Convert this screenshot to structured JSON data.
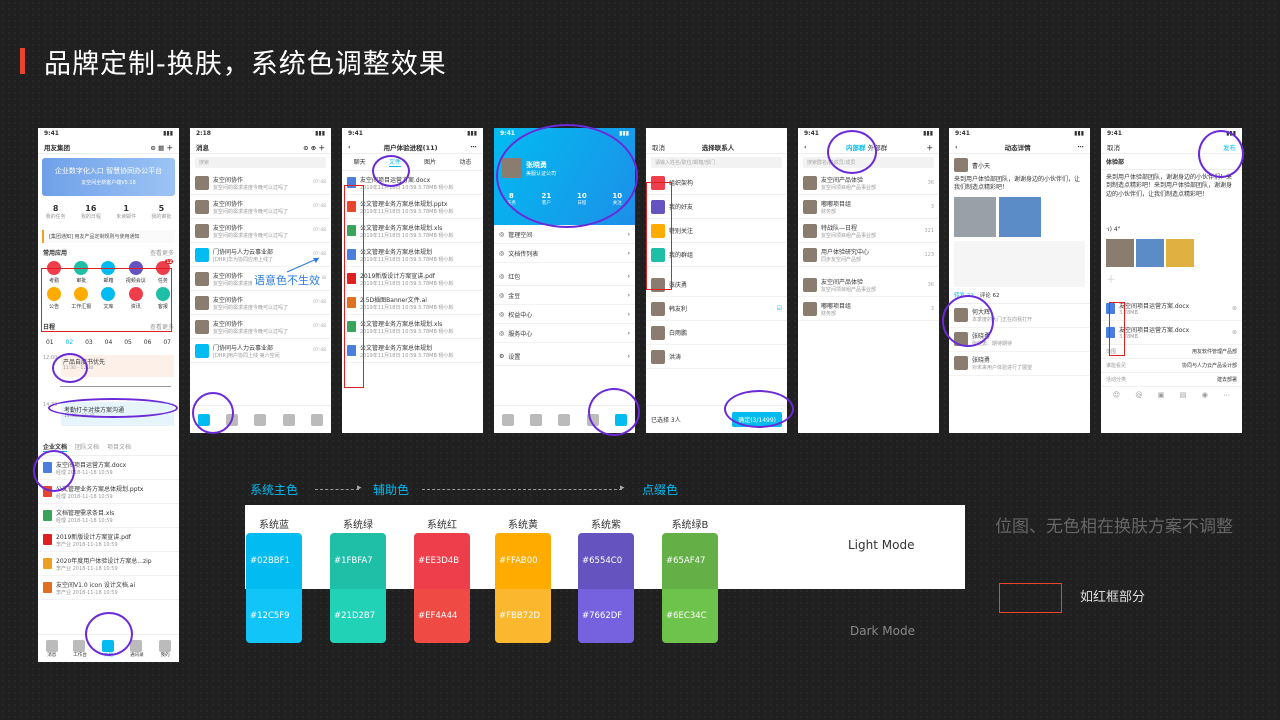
{
  "page_title": "品牌定制-换肤，系统色调整效果",
  "phone1": {
    "time": "9:41",
    "org": "用友集团",
    "banner": "企业数字化入口 智慧协同办公平台",
    "banner_sub": "友空间全新客户端V5.18",
    "stats": [
      {
        "v": "8",
        "l": "我的任务"
      },
      {
        "v": "16",
        "l": "我的日程"
      },
      {
        "v": "1",
        "l": "未读邮件"
      },
      {
        "v": "5",
        "l": "我的审批"
      }
    ],
    "notice": "[集团通知] 用友产品定制规则与使用通知",
    "apps_title": "常用应用",
    "apps_more": "查看更多",
    "apps": [
      "考勤",
      "审批",
      "邮箱",
      "视频会议",
      "任务",
      "公告",
      "工作汇报",
      "文库",
      "资讯",
      "客报"
    ],
    "apps_badge": "12",
    "cal_title": "日程",
    "cal_more": "查看更多",
    "days": [
      "01",
      "02",
      "03",
      "04",
      "05",
      "06",
      "07"
    ],
    "events": [
      {
        "t": "12:00",
        "n": "产品自度书优先",
        "s": "11:30 - 12:30"
      },
      {
        "t": "14:30",
        "n": "考勤打卡对接方案沟通",
        "s": "14:30 - 15:30"
      }
    ],
    "doc_tabs": [
      "企业文档",
      "团队文档",
      "项目文档"
    ],
    "docs": [
      {
        "n": "友空间项目运营方案.docx",
        "m": "经理 2018-11-18 10:59",
        "c": "#4a7fe0"
      },
      {
        "n": "公文管理业务方案总体规划.pptx",
        "m": "经理 2018-11-18 10:59",
        "c": "#e8452c"
      },
      {
        "n": "文档管理需求条目.xls",
        "m": "经理 2018-11-18 10:59",
        "c": "#3aa55a"
      },
      {
        "n": "2019新版设计方案宣讲.pdf",
        "m": "李产业 2018-11-18 10:59",
        "c": "#e02020"
      },
      {
        "n": "2020年度用户体验设计方案总...zip",
        "m": "李产业 2018-11-18 10:59",
        "c": "#f0a020"
      },
      {
        "n": "友空间V1.0 icon 设计文档.ai",
        "m": "李产业 2018-11-18 10:59",
        "c": "#e07020"
      }
    ],
    "tabs": [
      "消息",
      "工作台",
      "文档",
      "通讯录",
      "我的"
    ]
  },
  "phone2": {
    "time": "2:18",
    "title": "消息",
    "search": "搜索",
    "items": [
      {
        "n": "友空间协作",
        "s": "友空间的需求进度今晚可以过吗了",
        "t": "07:48"
      },
      {
        "n": "友空间协作",
        "s": "友空间的需求进度今晚可以过吗了",
        "t": "07:48"
      },
      {
        "n": "友空间协作",
        "s": "友空间的需求进度今晚可以过吗了",
        "t": "07:48"
      },
      {
        "n": "门协同与人力云事业部",
        "s": "[DHR]华为协同应用上线了",
        "t": "07:48"
      },
      {
        "n": "友空间协作",
        "s": "友空间的需求进度今晚可以过吗了",
        "t": "07:48"
      },
      {
        "n": "友空间协作",
        "s": "友空间的需求进度今晚可以过吗了",
        "t": "07:48"
      },
      {
        "n": "友空间协作",
        "s": "友空间的需求进度今晚可以过吗了",
        "t": "07:48"
      },
      {
        "n": "门协同与人力云事业部",
        "s": "[DHR]用户协同上线 第六空间",
        "t": "07:48"
      }
    ],
    "note": "语意色不生效"
  },
  "phone3": {
    "time": "9:41",
    "title": "用户体验进程(11)",
    "tabs": [
      "聊天",
      "文件",
      "图片",
      "动态"
    ],
    "files": [
      {
        "n": "友空间项目运营方案.docx",
        "c": "#4a7fe0"
      },
      {
        "n": "公文管理业务方案总体规划.pptx",
        "c": "#e8452c"
      },
      {
        "n": "公文管理业务方案总体规划.xls",
        "c": "#3aa55a"
      },
      {
        "n": "公文管理业务方案总体规划",
        "c": "#4a7fe0"
      },
      {
        "n": "2019新版设计方案宣讲.pdf",
        "c": "#e02020"
      },
      {
        "n": "2.5D插图Banner文件.ai",
        "c": "#e07020"
      },
      {
        "n": "公文管理业务方案总体规划.xls",
        "c": "#3aa55a"
      },
      {
        "n": "公文管理业务方案总体规划",
        "c": "#4a7fe0"
      }
    ],
    "meta": "2019年11月18日 10:59  3.78MB  杨小彬"
  },
  "phone4": {
    "time": "9:41",
    "name": "张晓勇",
    "sub": "美服认证公司",
    "stats": [
      {
        "v": "8",
        "l": "任务"
      },
      {
        "v": "21",
        "l": "客户"
      },
      {
        "v": "10",
        "l": "日程"
      },
      {
        "v": "10",
        "l": "关注"
      }
    ],
    "menu": [
      "管理空间",
      "文档传列表",
      "红包",
      "金豆",
      "权益中心",
      "服务中心",
      "设置"
    ]
  },
  "phone5": {
    "cancel": "取消",
    "title": "选择联系人",
    "search": "请输入姓名/职位/邮箱/部门",
    "cats": [
      "组织架构",
      "我的好友",
      "特别关注",
      "我的群组"
    ],
    "cat_colors": [
      "#EE3D4B",
      "#6554C0",
      "#FFAB00",
      "#1FBFA7"
    ],
    "people": [
      "张庆勇",
      "韩友利",
      "白雨鹏",
      "洪涛"
    ],
    "selected": "已选择 3人",
    "confirm": "确定(3/1499)"
  },
  "phone6": {
    "time": "9:41",
    "tabs": [
      "内部群",
      "外部群"
    ],
    "search": "搜索群名/群成员/成员",
    "groups": [
      {
        "n": "友空间产品体验",
        "s": "友空间项目组产品事业部",
        "c": "36"
      },
      {
        "n": "嘟嘟项目组",
        "s": "财务部",
        "c": "3"
      },
      {
        "n": "特战队—日程",
        "s": "友空间项目组产品事业部",
        "c": "321"
      },
      {
        "n": "用户体验研究中心",
        "s": "同步友空间产品部",
        "c": "123"
      },
      {
        "n": "友空间产品体验",
        "s": "友空间项目组产品事业部",
        "c": "36"
      },
      {
        "n": "嘟嘟项目组",
        "s": "财务部",
        "c": "3"
      }
    ]
  },
  "phone7": {
    "time": "9:41",
    "title": "动态详情",
    "author": "曹小天",
    "text": "来到用户体验部团队，谢谢身边的小伙伴们，让我们制造点精彩吧！",
    "tabs": [
      "转发 22",
      "评论 62"
    ],
    "comments": [
      {
        "n": "何大辉",
        "s": "本季度的大门正在向我打开"
      },
      {
        "n": "张晓勇",
        "s": "张晓勇：期待期待"
      },
      {
        "n": "张晓勇",
        "s": "对未来用户体验进行了展望"
      }
    ]
  },
  "phone8": {
    "time": "9:41",
    "cancel": "取消",
    "publish": "发布",
    "group": "体验部",
    "text": "来到用户体验部团队，谢谢身边的小伙伴们！来到制造点精彩吧！来到用户体验部团队，谢谢身边的小伙伴们，让我们制造点精彩吧！",
    "voice": "·ı) 4\"",
    "files": [
      {
        "n": "友空间项目运营方案.docx",
        "s": "3.78MB"
      },
      {
        "n": "友空间项目运营方案.docx",
        "s": "3.78MB"
      }
    ],
    "meta": [
      {
        "l": "范围",
        "v": "用友软件管理产品部"
      },
      {
        "l": "谁能看见",
        "v": "协同与人力云产品设计部"
      },
      {
        "l": "活动分类",
        "v": "建去部署"
      }
    ]
  },
  "legend": {
    "main": "系统主色",
    "aux": "辅助色",
    "accent": "点缀色",
    "light": "Light Mode",
    "dark": "Dark Mode",
    "note": "位图、无色相在换肤方案不调整",
    "box_label": "如红框部分",
    "swatches": [
      {
        "name": "系统蓝",
        "light": "#02BBF1",
        "dark": "#12C5F9"
      },
      {
        "name": "系统绿",
        "light": "#1FBFA7",
        "dark": "#21D2B7"
      },
      {
        "name": "系统红",
        "light": "#EE3D4B",
        "dark": "#EF4A44"
      },
      {
        "name": "系统黄",
        "light": "#FFAB00",
        "dark": "#FBB72D"
      },
      {
        "name": "系统紫",
        "light": "#6554C0",
        "dark": "#7662DF"
      },
      {
        "name": "系统绿B",
        "light": "#65AF47",
        "dark": "#6EC34C"
      }
    ],
    "accent_color": "#02BBF1",
    "ring_color": "#6b2ad8",
    "box_color": "#e8452c"
  }
}
